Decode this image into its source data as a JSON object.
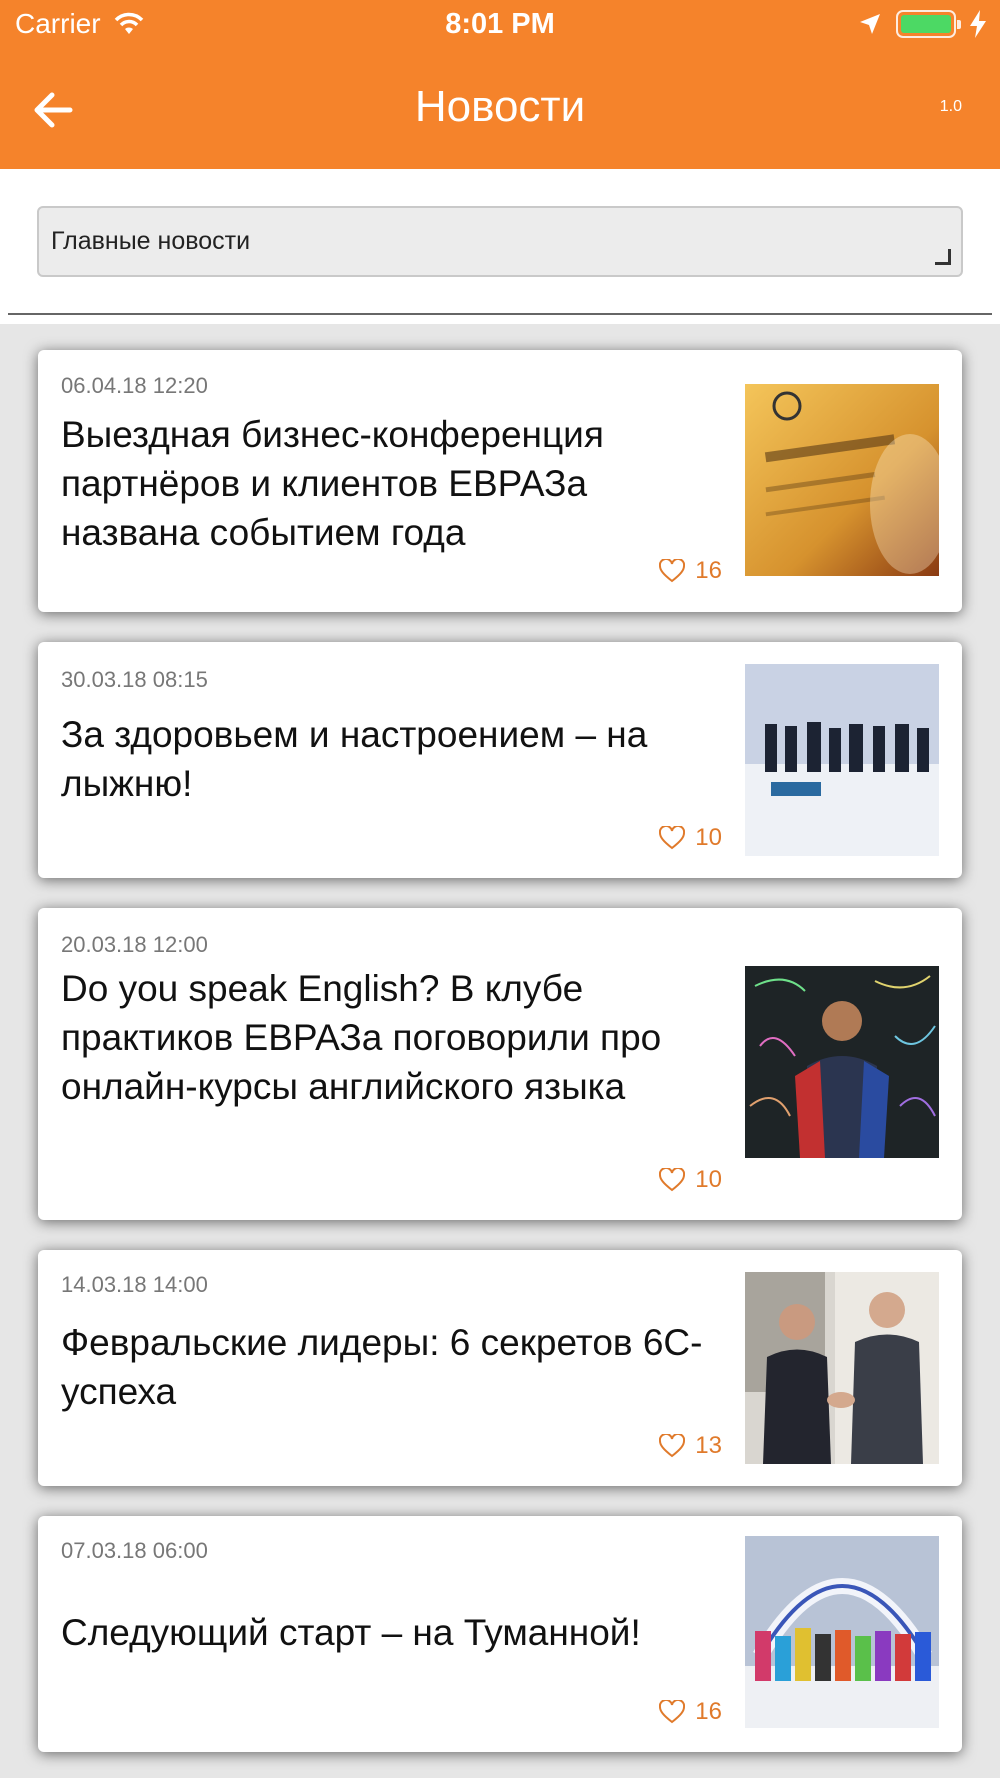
{
  "status_bar": {
    "carrier": "Carrier",
    "time": "8:01 PM"
  },
  "header": {
    "title": "Новости",
    "version": "1.0",
    "back_icon": "arrow-left-icon",
    "color": "#f5832b"
  },
  "filter": {
    "selected": "Главные новости"
  },
  "news": [
    {
      "date": "06.04.18 12:20",
      "title": "Выездная бизнес-конференция партнёров и клиентов ЕВРАЗа названа событием года",
      "likes": "16"
    },
    {
      "date": "30.03.18 08:15",
      "title": "За здоровьем и настроением – на лыжню!",
      "likes": "10"
    },
    {
      "date": "20.03.18 12:00",
      "title": "Do you speak English? В клубе практиков ЕВРАЗа поговорили про онлайн-курсы английского языка",
      "likes": "10"
    },
    {
      "date": "14.03.18 14:00",
      "title": "Февральские лидеры: 6 секретов 6С-успеха",
      "likes": "13"
    },
    {
      "date": "07.03.18 06:00",
      "title": "Следующий старт – на Туманной!",
      "likes": "16"
    }
  ],
  "accent_color": "#e07a2b"
}
